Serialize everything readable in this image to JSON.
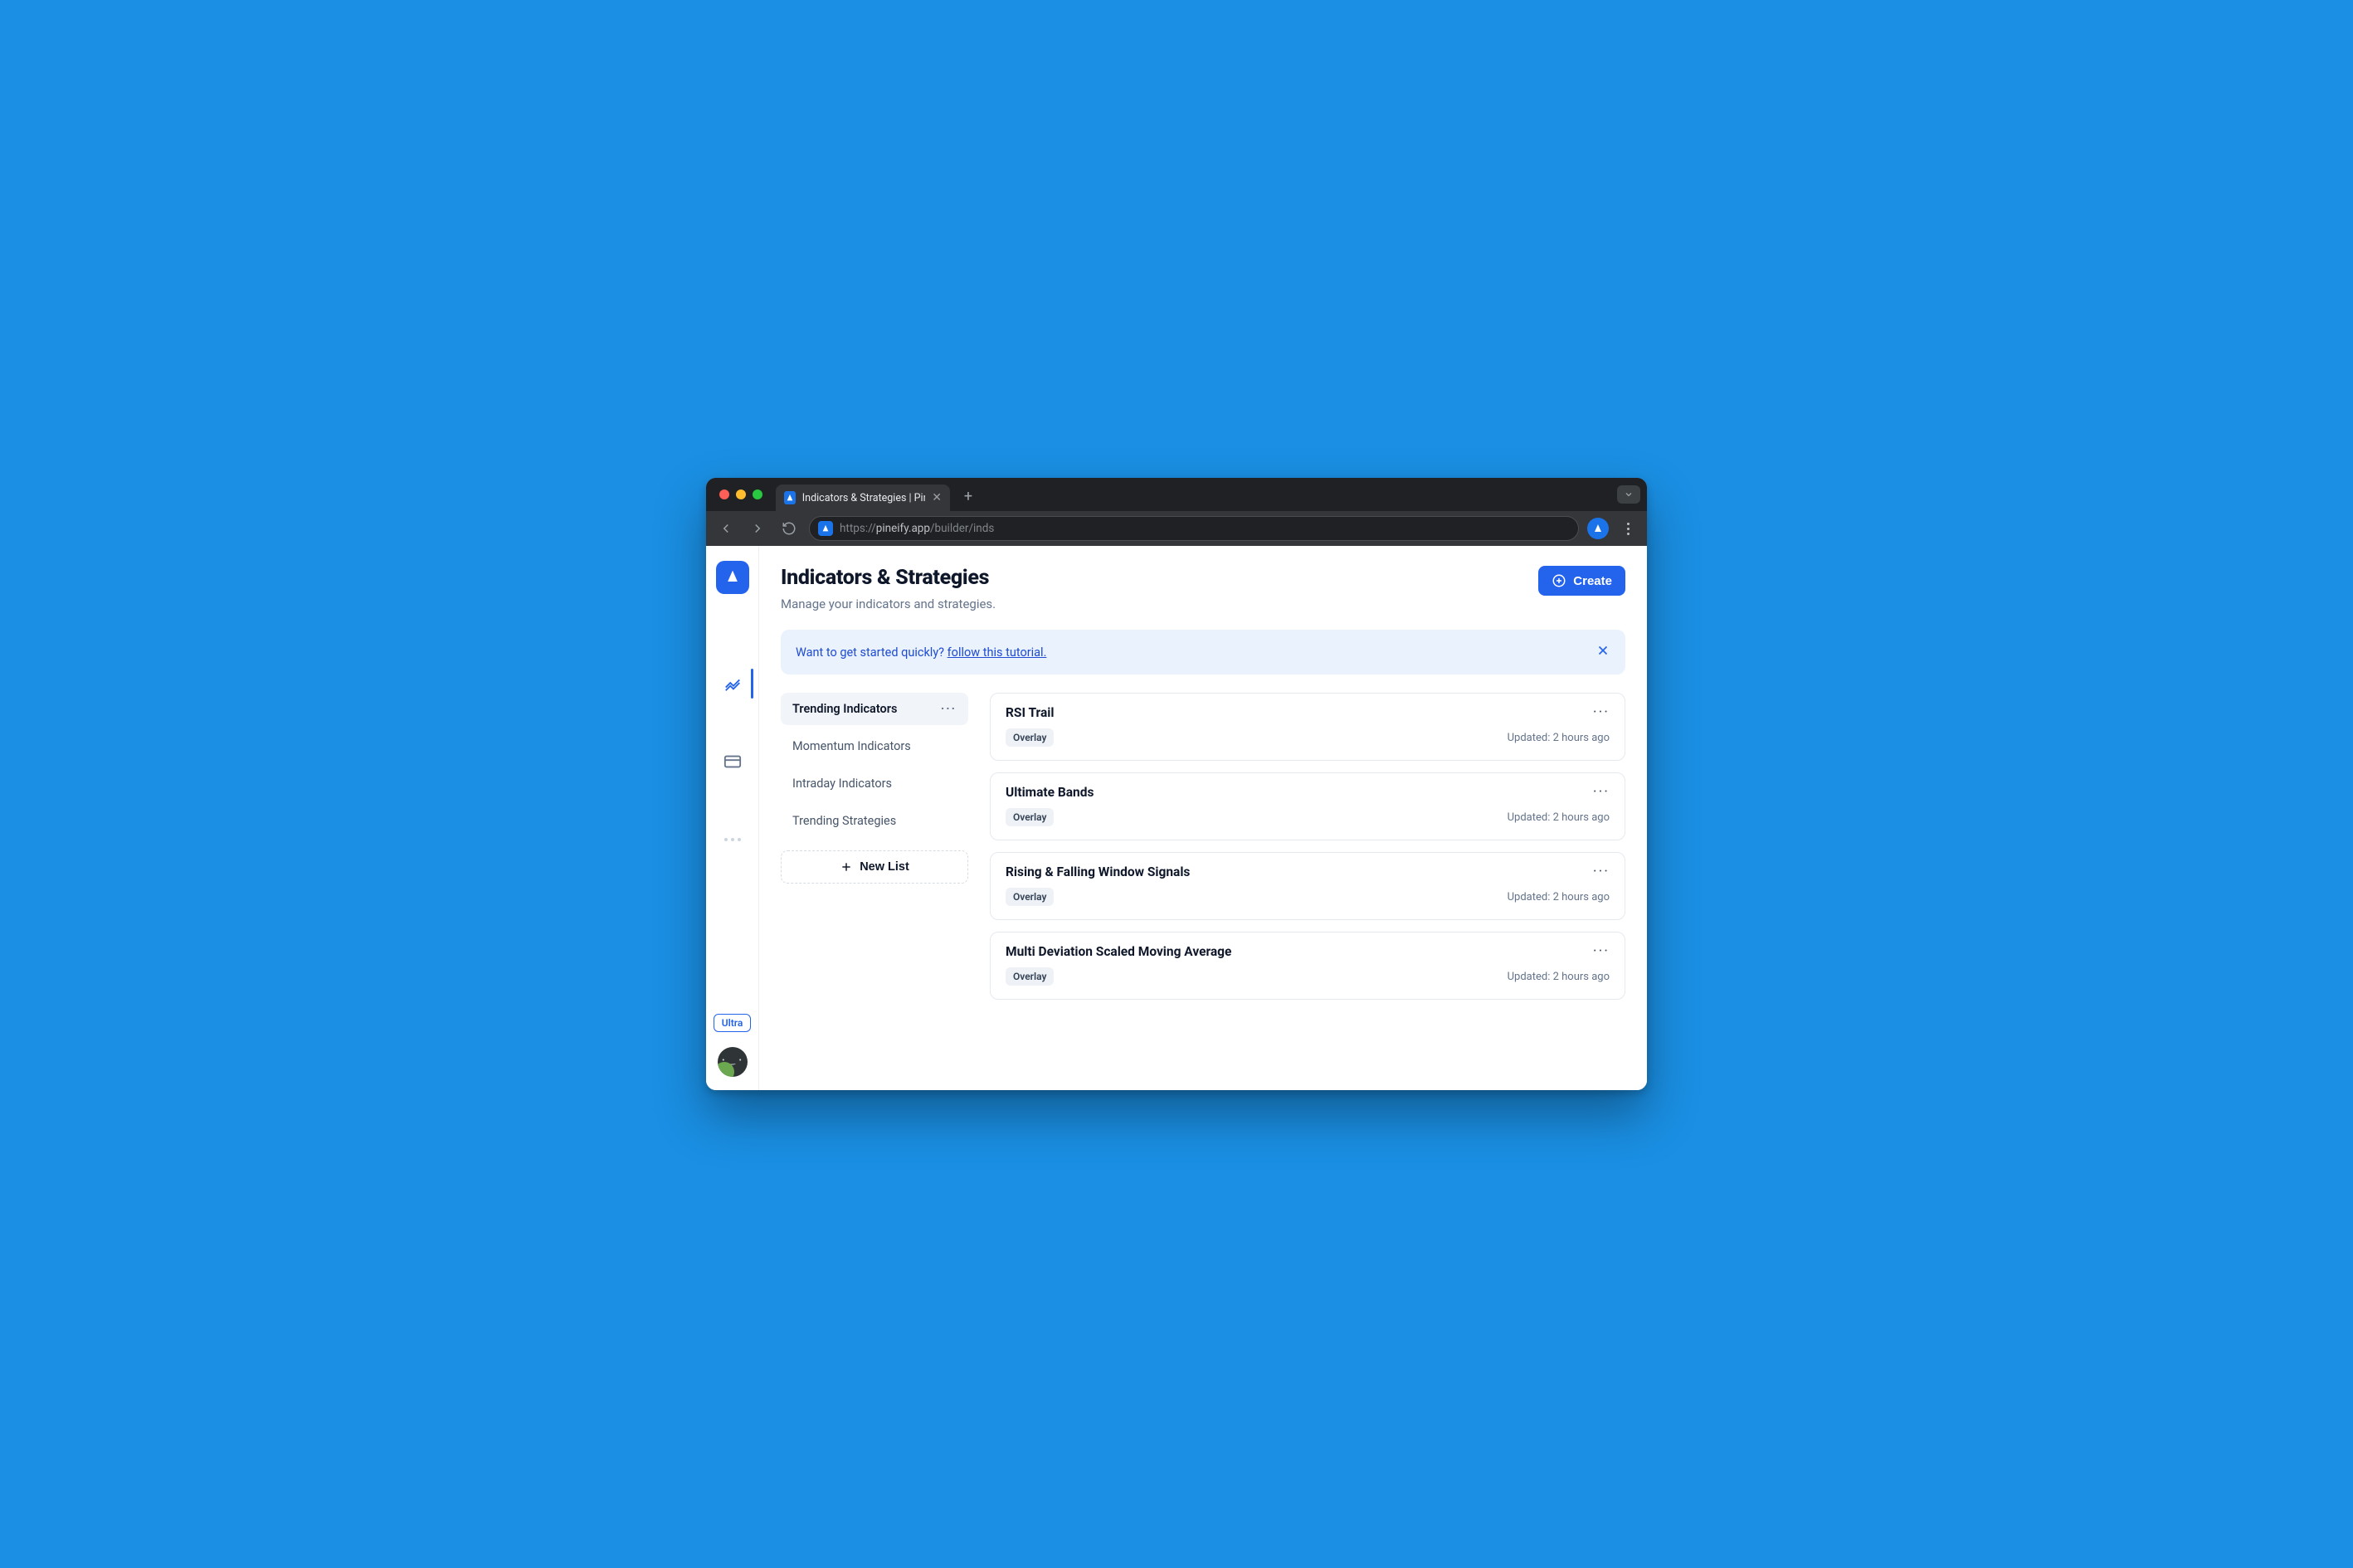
{
  "browser": {
    "tab_title": "Indicators & Strategies | Pineify",
    "url_prefix": "https://",
    "url_host": "pineify.app",
    "url_path": "/builder/inds"
  },
  "sidebar": {
    "ultra_label": "Ultra"
  },
  "header": {
    "title": "Indicators & Strategies",
    "subtitle": "Manage your indicators and strategies.",
    "create_label": "Create"
  },
  "banner": {
    "text": "Want to get started quickly? ",
    "link": "follow this tutorial."
  },
  "lists": {
    "items": [
      {
        "label": "Trending Indicators",
        "active": true
      },
      {
        "label": "Momentum Indicators",
        "active": false
      },
      {
        "label": "Intraday Indicators",
        "active": false
      },
      {
        "label": "Trending Strategies",
        "active": false
      }
    ],
    "new_list_label": "New List"
  },
  "cards": [
    {
      "title": "RSI Trail",
      "tag": "Overlay",
      "updated": "Updated: 2 hours ago"
    },
    {
      "title": "Ultimate Bands",
      "tag": "Overlay",
      "updated": "Updated: 2 hours ago"
    },
    {
      "title": "Rising & Falling Window Signals",
      "tag": "Overlay",
      "updated": "Updated: 2 hours ago"
    },
    {
      "title": "Multi Deviation Scaled Moving Average",
      "tag": "Overlay",
      "updated": "Updated: 2 hours ago"
    }
  ]
}
